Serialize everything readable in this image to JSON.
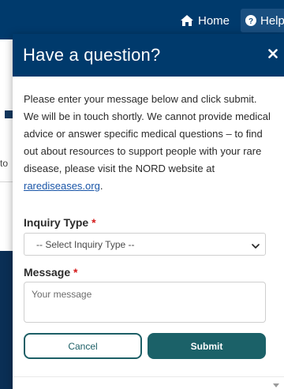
{
  "nav": {
    "home_label": "Home",
    "help_label": "Help"
  },
  "background": {
    "partial_text": "to"
  },
  "modal": {
    "title": "Have a question?",
    "intro_text": "Please enter your message below and click submit. We will be in touch shortly. We cannot provide medical advice or answer specific medical questions – to find out about resources to support people with your rare disease, please visit the NORD website at ",
    "intro_link": "rarediseases.org",
    "intro_end": ".",
    "inquiry_label": "Inquiry Type",
    "inquiry_required": "*",
    "inquiry_selected": "-- Select Inquiry Type --",
    "message_label": "Message",
    "message_required": "*",
    "message_placeholder": "Your message",
    "cancel_label": "Cancel",
    "submit_label": "Submit"
  },
  "icons": {
    "home": "home-icon",
    "help": "question-circle-icon",
    "close": "close-icon",
    "chevron": "chevron-down-icon",
    "scroll": "scroll-down-arrow-icon"
  },
  "colors": {
    "header": "#003a6c",
    "submit": "#1b6168",
    "required": "#d41a1a",
    "link": "#1a56a8"
  }
}
